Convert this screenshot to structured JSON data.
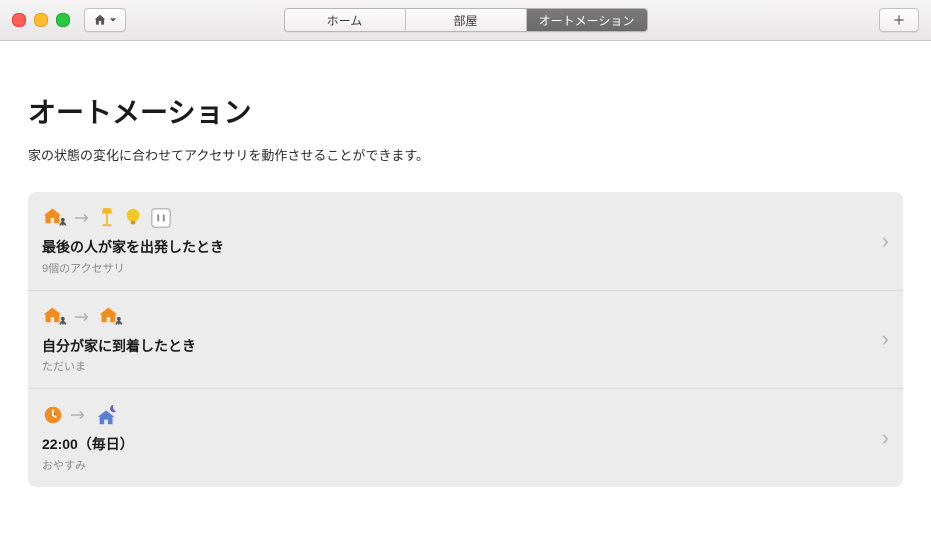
{
  "tabs": {
    "home": "ホーム",
    "room": "部屋",
    "automation": "オートメーション"
  },
  "page": {
    "title": "オートメーション",
    "subtitle": "家の状態の変化に合わせてアクセサリを動作させることができます。"
  },
  "automations": [
    {
      "title": "最後の人が家を出発したとき",
      "subtitle": "9個のアクセサリ"
    },
    {
      "title": "自分が家に到着したとき",
      "subtitle": "ただいま"
    },
    {
      "title": "22:00（毎日）",
      "subtitle": "おやすみ"
    }
  ]
}
